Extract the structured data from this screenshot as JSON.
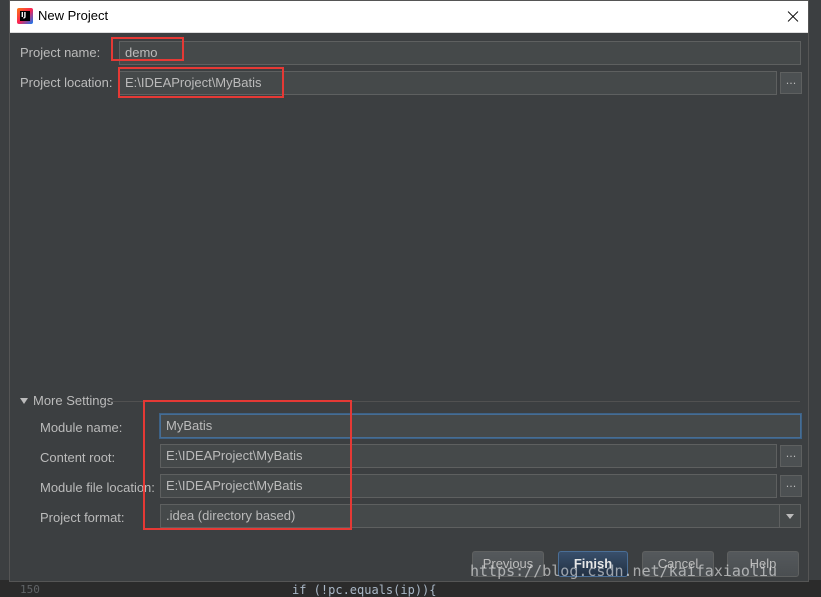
{
  "window": {
    "title": "New Project",
    "close_icon": "close-icon",
    "app_icon": "intellij-idea-icon",
    "app_icon_text": "IJ"
  },
  "form": {
    "project_name_label": "Project name:",
    "project_name_value": "demo",
    "project_location_label": "Project location:",
    "project_location_value": "E:\\IDEAProject\\MyBatis",
    "browse_label": "..."
  },
  "more_settings": {
    "header": "More Settings",
    "module_name_label": "Module name:",
    "module_name_value": "MyBatis",
    "content_root_label": "Content root:",
    "content_root_value": "E:\\IDEAProject\\MyBatis",
    "module_file_location_label": "Module file location:",
    "module_file_location_value": "E:\\IDEAProject\\MyBatis",
    "project_format_label": "Project format:",
    "project_format_value": ".idea (directory based)"
  },
  "buttons": {
    "previous": "Previous",
    "finish": "Finish",
    "cancel": "Cancel",
    "help": "Help"
  },
  "background": {
    "line_number": "150",
    "code": "if (!pc.equals(ip)){"
  },
  "watermark": "https://blog.csdn.net/kaifaxiaoliu",
  "colors": {
    "annotation_red": "#e53935",
    "dialog_bg": "#3c3f41",
    "focus_blue": "#466d94"
  }
}
